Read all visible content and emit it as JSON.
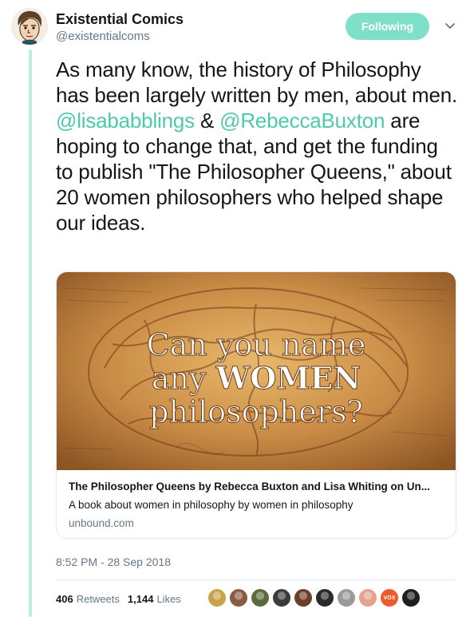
{
  "user": {
    "name": "Existential Comics",
    "handle": "@existentialcoms"
  },
  "follow_button": {
    "label": "Following"
  },
  "tweet": {
    "text_1": "As many know, the history of Philosophy has been largely written by men, about men. ",
    "mention_1": "@lisababblings",
    "text_2": " & ",
    "mention_2": "@RebeccaBuxton",
    "text_3": " are hoping to change that, and get the funding to publish \"The Philosopher Queens,\" about 20 women philosophers who helped shape our ideas."
  },
  "card": {
    "image_line1": "Can you name",
    "image_line2a": "any ",
    "image_line2b": "WOMEN",
    "image_line3": "philosophers?",
    "title": "The Philosopher Queens by Rebecca Buxton and Lisa Whiting on Un...",
    "description": "A book about women in philosophy by women in philosophy",
    "domain": "unbound.com"
  },
  "timestamp": "8:52 PM - 28 Sep 2018",
  "stats": {
    "retweets_count": "406",
    "retweets_label": "Retweets",
    "likes_count": "1,144",
    "likes_label": "Likes"
  },
  "likers": [
    {
      "color": "#c9a34a"
    },
    {
      "color": "#8a5a44"
    },
    {
      "color": "#5b6b3a"
    },
    {
      "color": "#3b3b3b"
    },
    {
      "color": "#6b3f2a"
    },
    {
      "color": "#2a2a2a"
    },
    {
      "color": "#9a9a9a"
    },
    {
      "color": "#e4a18f"
    },
    {
      "color": "#ef5a2a",
      "label": "VOX"
    },
    {
      "color": "#1f1f1f"
    }
  ],
  "colors": {
    "accent": "#4ec9ad",
    "follow_bg": "#7ee0c8",
    "thread_line": "#b9f0e3"
  }
}
